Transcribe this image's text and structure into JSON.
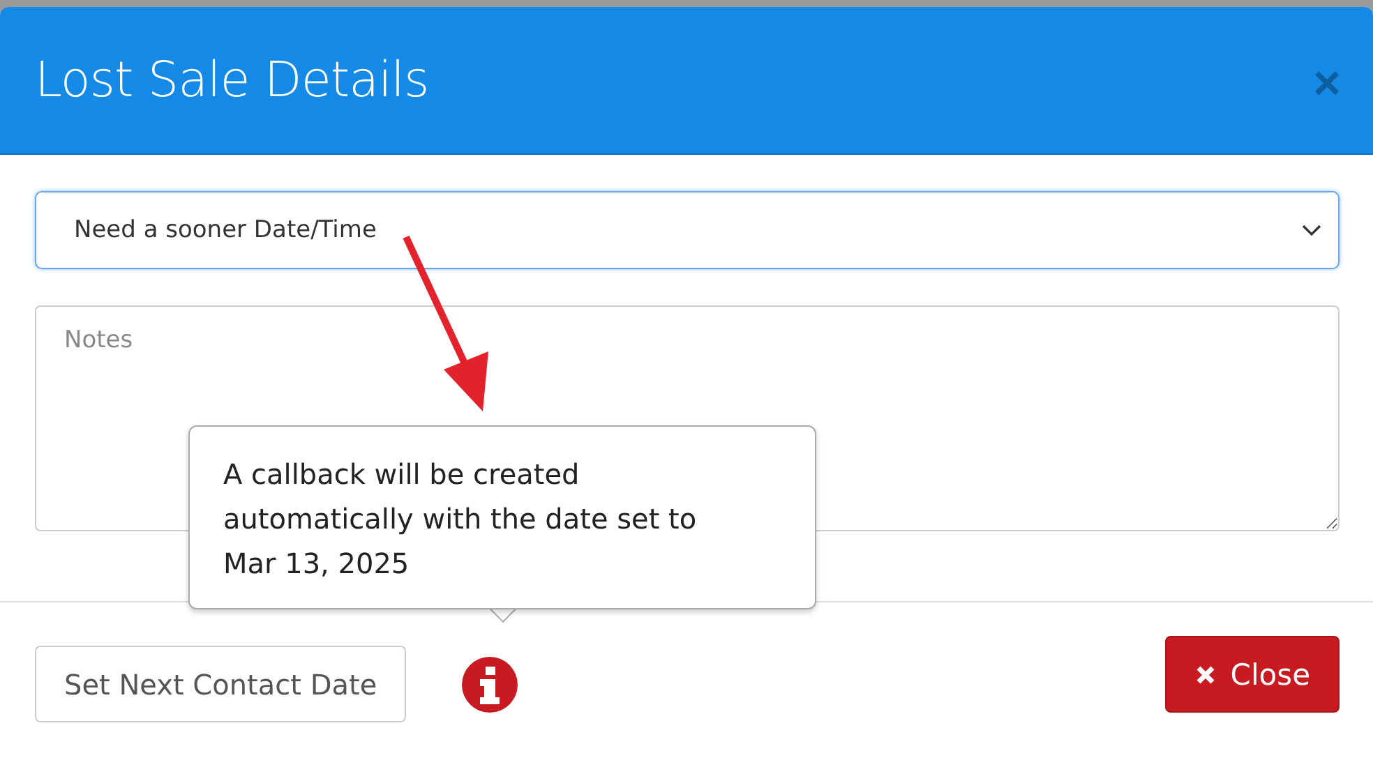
{
  "dialog": {
    "title": "Lost Sale Details",
    "close_icon": "×"
  },
  "reason_select": {
    "value": "Need a sooner Date/Time"
  },
  "notes": {
    "placeholder": "Notes"
  },
  "tooltip": {
    "text": "A callback will be created automatically with the date set to Mar 13, 2025"
  },
  "footer": {
    "set_date_button": "Set Next Contact Date",
    "close_button": "Close"
  }
}
